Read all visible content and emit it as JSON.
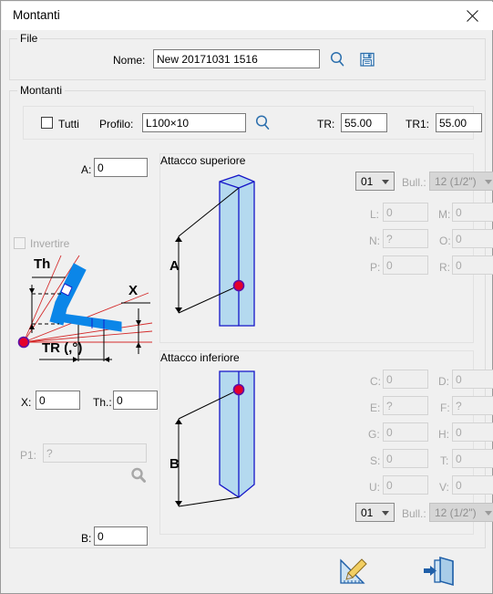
{
  "window": {
    "title": "Montanti",
    "close_icon": "close-icon"
  },
  "file_group": {
    "legend": "File",
    "nome_label": "Nome:",
    "nome_value": "New 20171031 1516",
    "search_icon": "magnifier-icon",
    "save_icon": "floppy-disk-save-icon"
  },
  "montanti_group": {
    "legend": "Montanti",
    "tutti_label": "Tutti",
    "tutti_checked": false,
    "profilo_label": "Profilo:",
    "profilo_value": "L100×10",
    "profilo_search_icon": "magnifier-icon",
    "tr_label": "TR:",
    "tr_value": "55.00",
    "tr1_label": "TR1:",
    "tr1_value": "55.00",
    "a_label": "A:",
    "a_value": "0",
    "b_label": "B:",
    "b_value": "0",
    "invertire_label": "Invertire",
    "invertire_checked": false,
    "diagram": {
      "th_label": "Th",
      "x_label": "X",
      "tr_label": "TR (,°)"
    },
    "x_label": "X:",
    "x_value": "0",
    "th_label": "Th.:",
    "th_value": "0",
    "p1_label": "P1:",
    "p1_value": "?",
    "p1_icon": "magnifier-icon"
  },
  "attacco_superiore": {
    "legend": "Attacco superiore",
    "diagram_dim_label": "A",
    "number_combo": "01",
    "bull_label": "Bull.:",
    "bull_combo": "12 (1/2\")",
    "fields": [
      {
        "label": "L:",
        "value": "0"
      },
      {
        "label": "M:",
        "value": "0"
      },
      {
        "label": "N:",
        "value": "?"
      },
      {
        "label": "O:",
        "value": "0"
      },
      {
        "label": "P:",
        "value": "0"
      },
      {
        "label": "R:",
        "value": "0"
      }
    ]
  },
  "attacco_inferiore": {
    "legend": "Attacco inferiore",
    "diagram_dim_label": "B",
    "number_combo": "01",
    "bull_label": "Bull.:",
    "bull_combo": "12 (1/2\")",
    "fields": [
      {
        "label": "C:",
        "value": "0"
      },
      {
        "label": "D:",
        "value": "0"
      },
      {
        "label": "E:",
        "value": "?"
      },
      {
        "label": "F:",
        "value": "?"
      },
      {
        "label": "G:",
        "value": "0"
      },
      {
        "label": "H:",
        "value": "0"
      },
      {
        "label": "S:",
        "value": "0"
      },
      {
        "label": "T:",
        "value": "0"
      },
      {
        "label": "U:",
        "value": "0"
      },
      {
        "label": "V:",
        "value": "0"
      }
    ]
  },
  "footer": {
    "draw_icon": "triangle-ruler-pencil-icon",
    "exit_icon": "exit-door-icon"
  },
  "colors": {
    "accent_blue": "#2c6fad",
    "profile_fill": "#b4d9ef",
    "profile_stroke": "#1515c8",
    "marker_red": "#e4002b",
    "dim_red": "#d42a2a",
    "bend_blue": "#0b86e8"
  }
}
